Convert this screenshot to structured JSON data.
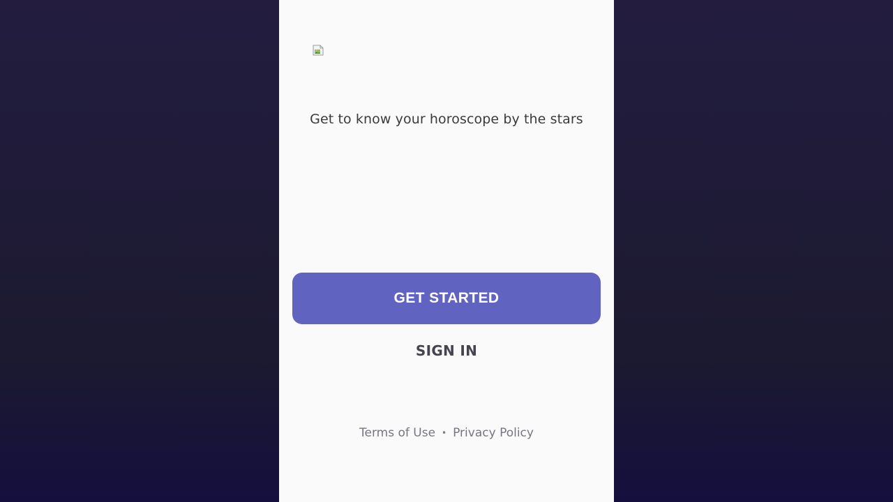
{
  "app": {
    "tagline": "Get to know your horoscope by the stars"
  },
  "logo": {
    "icon": "broken-image-icon"
  },
  "actions": {
    "primary_label": "GET STARTED",
    "secondary_label": "SIGN IN"
  },
  "footer": {
    "terms_label": "Terms of Use",
    "separator": "•",
    "privacy_label": "Privacy Policy"
  },
  "colors": {
    "background": "#1f1b38",
    "panel": "#fafafa",
    "primary_button": "#6063c0",
    "primary_button_text": "#ffffff",
    "secondary_button_text": "#45434f",
    "footer_text": "#77757f"
  }
}
